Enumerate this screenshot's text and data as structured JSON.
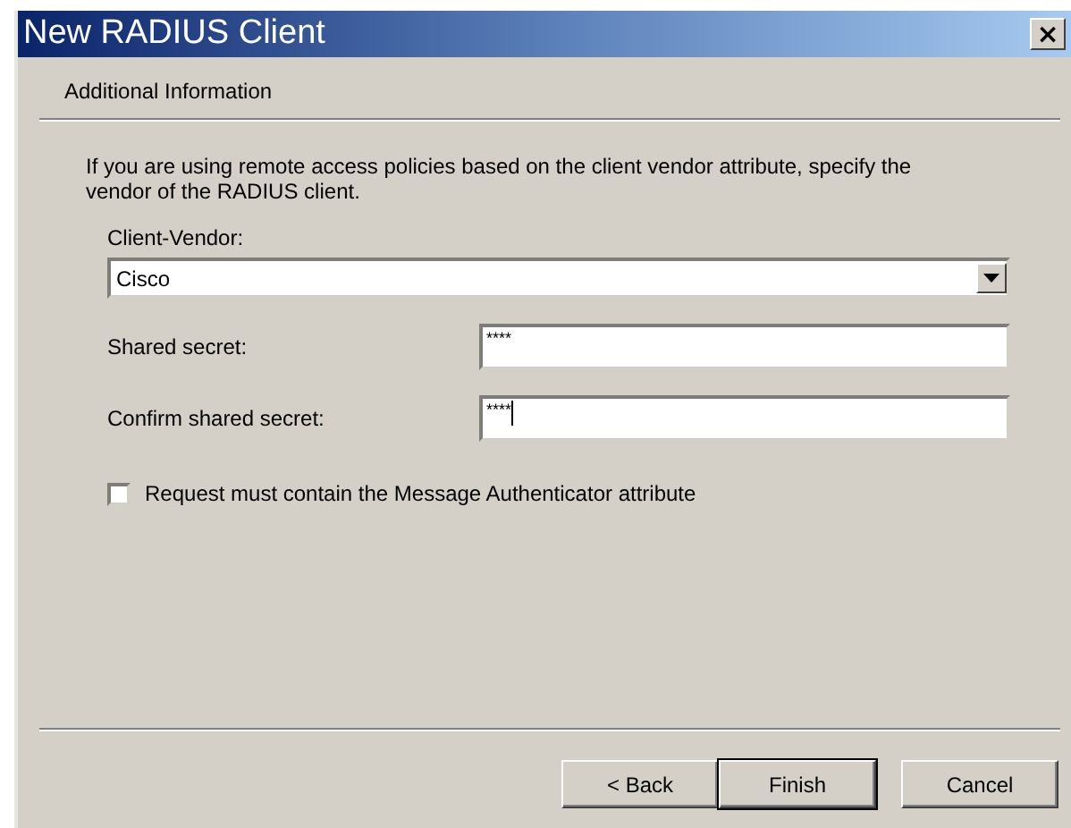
{
  "window": {
    "title": "New RADIUS Client",
    "close": "×"
  },
  "header": {
    "title": "Additional Information"
  },
  "description": "If you are using remote access policies based on the client vendor attribute, specify the vendor of the RADIUS client.",
  "vendor": {
    "label": "Client-Vendor:",
    "value": "Cisco"
  },
  "secrets": [
    {
      "label": "Shared secret:",
      "value": "****",
      "focused": false
    },
    {
      "label": "Confirm shared secret:",
      "value": "****",
      "focused": true
    }
  ],
  "authenticator": {
    "label": "Request must contain the Message Authenticator attribute",
    "checked": false
  },
  "buttons": [
    {
      "label": "< Back",
      "default": false
    },
    {
      "label": "Finish",
      "default": true
    },
    {
      "label": "Cancel",
      "default": false
    }
  ]
}
